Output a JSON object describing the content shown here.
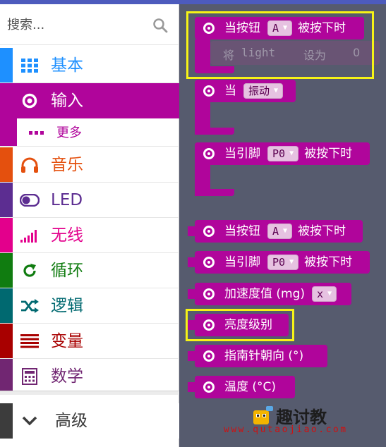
{
  "search": {
    "placeholder": "搜索..."
  },
  "categories": [
    {
      "id": "basic",
      "label": "基本",
      "color": "#1e90ff",
      "icon": "grid-icon"
    },
    {
      "id": "input",
      "label": "输入",
      "color": "#b0059b",
      "icon": "radio-icon",
      "selected": true
    },
    {
      "id": "more",
      "label": "更多",
      "color": "#b0059b",
      "icon": "dots-icon"
    },
    {
      "id": "music",
      "label": "音乐",
      "color": "#e4500e",
      "icon": "headphones-icon"
    },
    {
      "id": "led",
      "label": "LED",
      "color": "#5c2d91",
      "icon": "toggle-icon"
    },
    {
      "id": "radio",
      "label": "无线",
      "color": "#e3008c",
      "icon": "signal-icon"
    },
    {
      "id": "loops",
      "label": "循环",
      "color": "#107c10",
      "icon": "refresh-icon"
    },
    {
      "id": "logic",
      "label": "逻辑",
      "color": "#006970",
      "icon": "shuffle-icon"
    },
    {
      "id": "variables",
      "label": "变量",
      "color": "#a80000",
      "icon": "list-icon"
    },
    {
      "id": "math",
      "label": "数学",
      "color": "#712672",
      "icon": "calculator-icon"
    },
    {
      "id": "advanced",
      "label": "高级",
      "color": "#3c3c3c",
      "icon": "chevron-down-icon"
    }
  ],
  "blocks": {
    "button_pressed": {
      "pre": "当按钮",
      "dropdown": "A",
      "post": "被按下时"
    },
    "ghost_set": {
      "word1": "将",
      "var": "light",
      "word2": "设为",
      "value": "0"
    },
    "gesture": {
      "pre": "当",
      "dropdown": "振动"
    },
    "pin_pressed": {
      "pre": "当引脚",
      "dropdown": "P0",
      "post": "被按下时"
    },
    "button_is_pressed": {
      "pre": "当按钮",
      "dropdown": "A",
      "post": "被按下时"
    },
    "pin_is_pressed": {
      "pre": "当引脚",
      "dropdown": "P0",
      "post": "被按下时"
    },
    "acceleration": {
      "pre": "加速度值 (mg)",
      "dropdown": "x"
    },
    "light_level": {
      "pre": "亮度级别"
    },
    "compass": {
      "pre": "指南针朝向 (°)"
    },
    "temperature": {
      "pre": "温度 (°C)"
    }
  },
  "watermark": {
    "name": "趣讨教",
    "url": "www.qutaojiao.com"
  }
}
